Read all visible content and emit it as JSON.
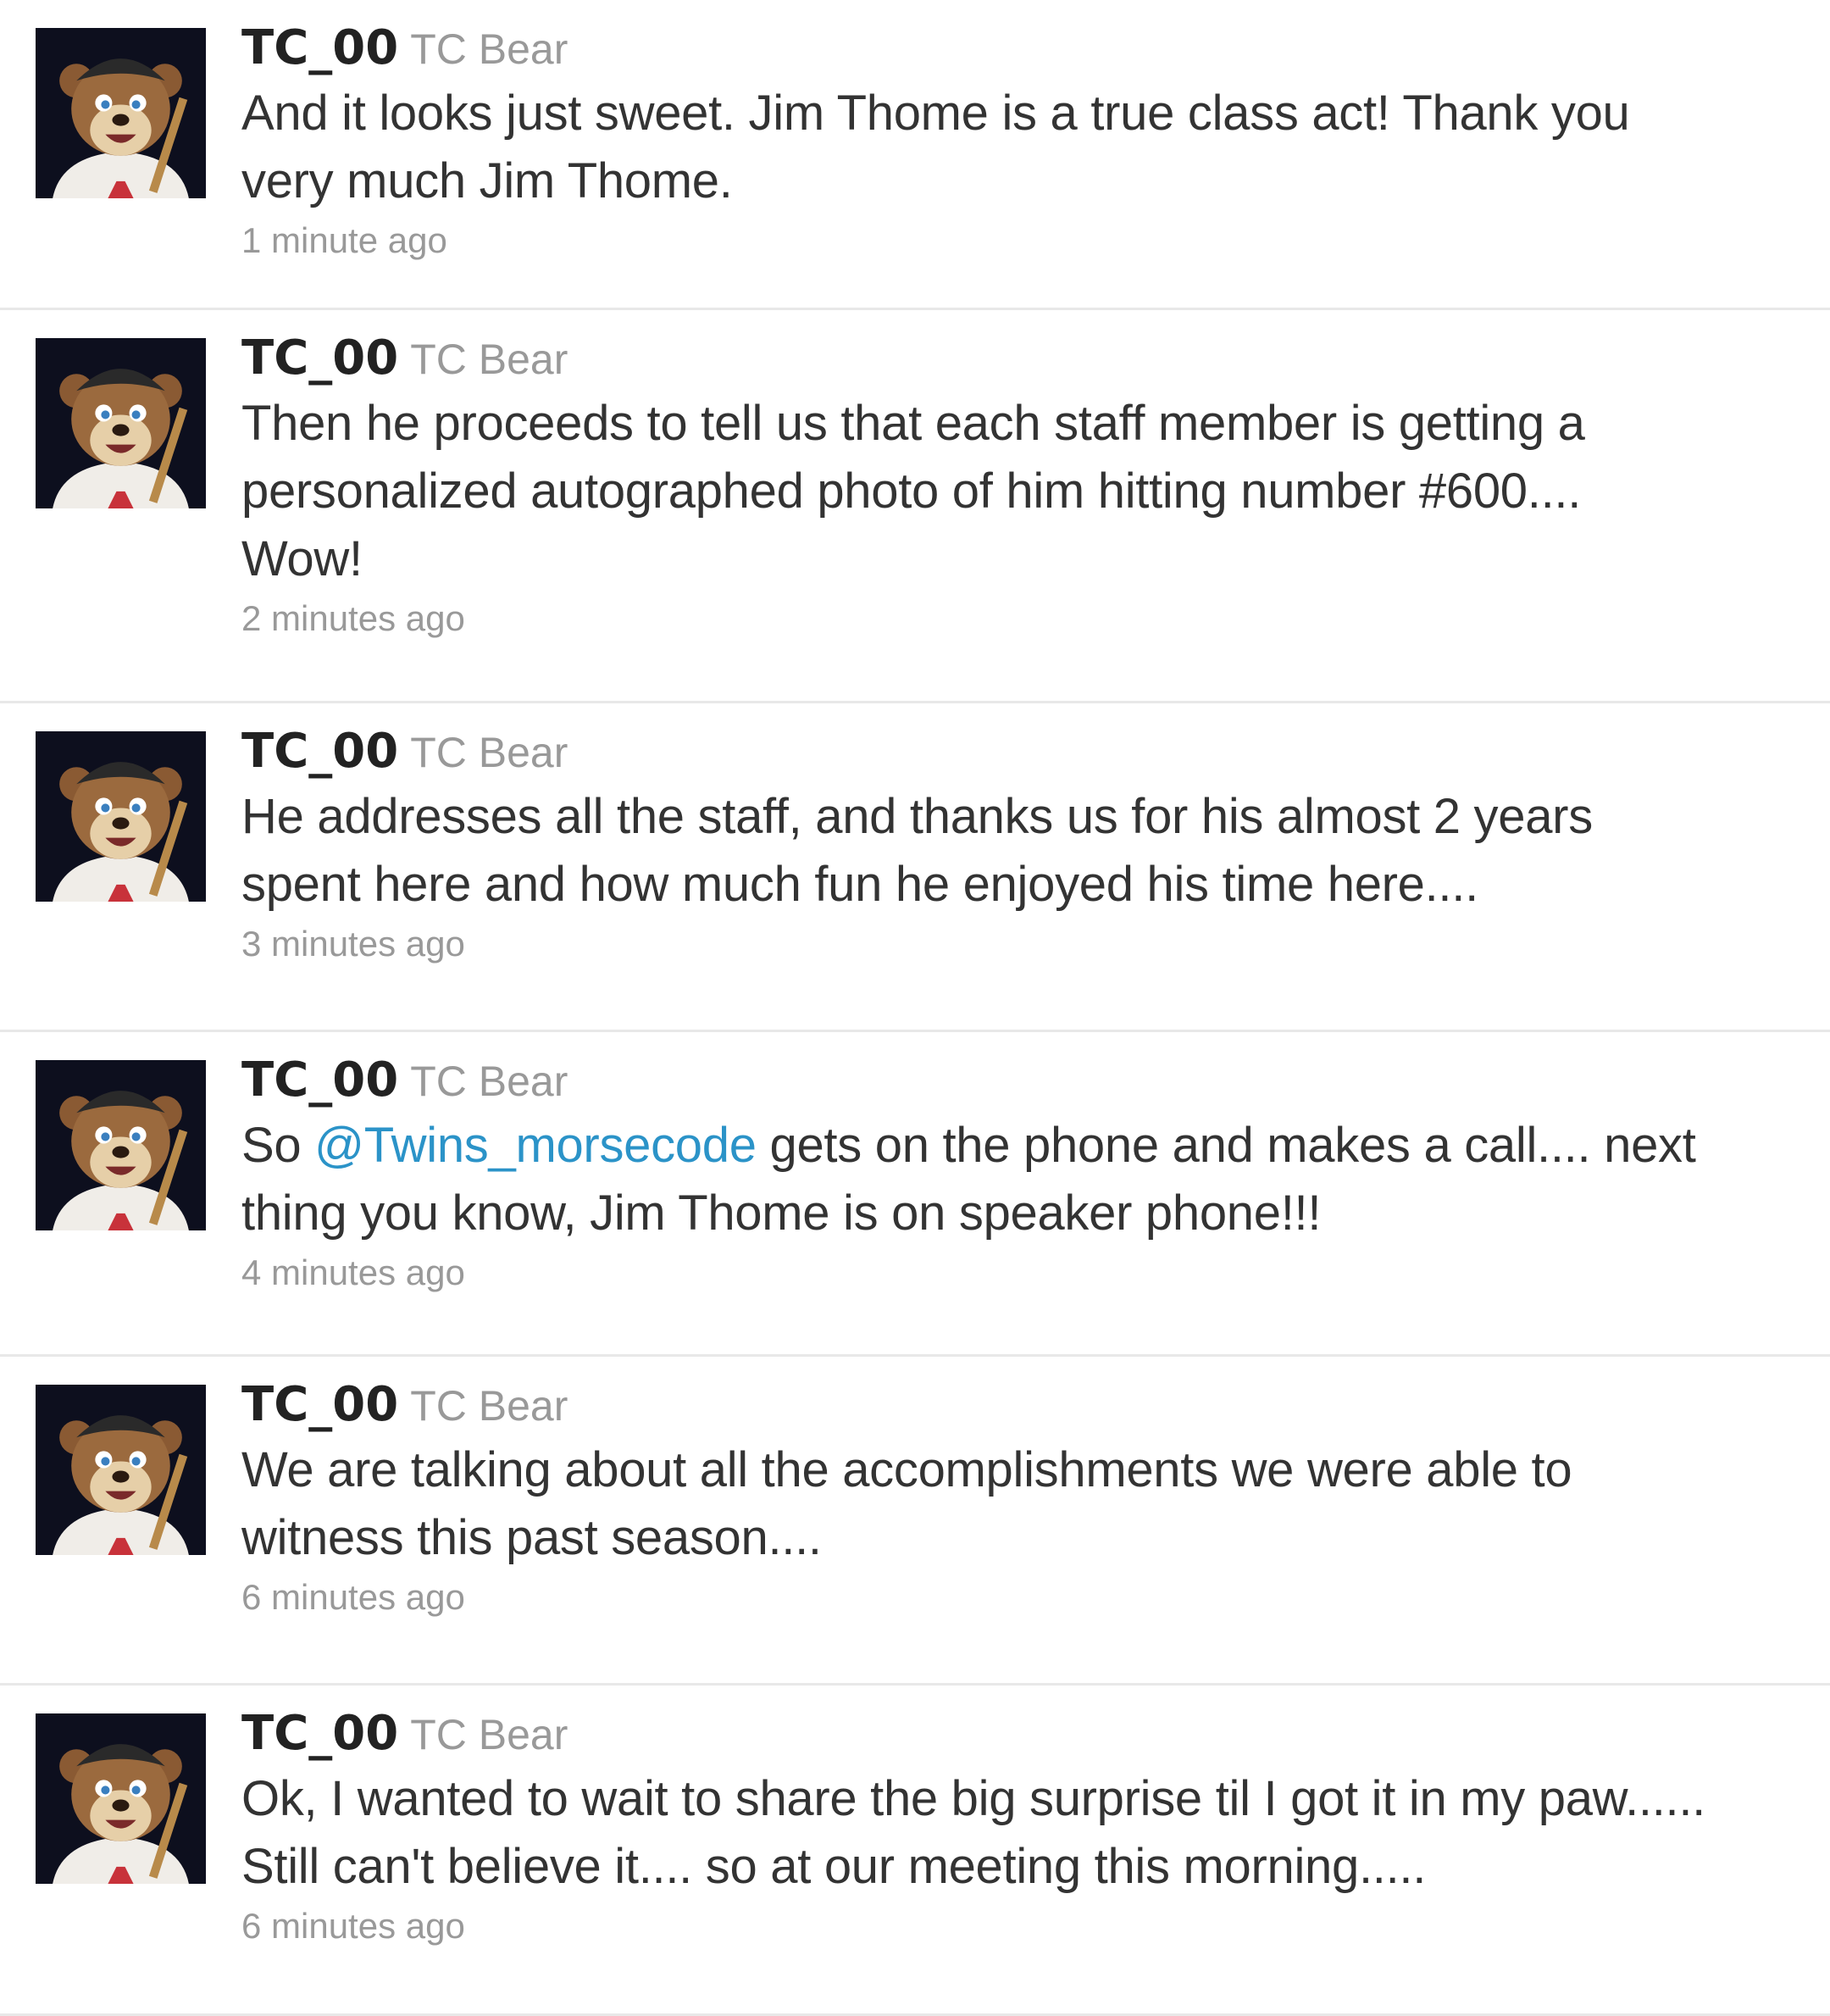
{
  "colors": {
    "screen_name": "#222222",
    "full_name": "#999999",
    "text": "#333333",
    "mention": "#2b93c8",
    "timestamp": "#999999",
    "divider": "#e8e8e8"
  },
  "tweets": [
    {
      "screen_name": "TC_00",
      "full_name": "TC Bear",
      "avatar_icon": "tc-bear-mascot-avatar",
      "lines": [
        {
          "text": "And it looks just sweet. Jim Thome is a true class act! Thank you"
        },
        {
          "text": "very much Jim Thome."
        }
      ],
      "timestamp": "1 minute ago"
    },
    {
      "screen_name": "TC_00",
      "full_name": "TC Bear",
      "avatar_icon": "tc-bear-mascot-avatar",
      "lines": [
        {
          "text": "Then he proceeds to tell us that each staff member is getting a"
        },
        {
          "text": "personalized autographed photo of him hitting number #600...."
        },
        {
          "text": "Wow!"
        }
      ],
      "timestamp": "2 minutes ago"
    },
    {
      "screen_name": "TC_00",
      "full_name": "TC Bear",
      "avatar_icon": "tc-bear-mascot-avatar",
      "lines": [
        {
          "text": "He addresses all the staff, and thanks us for his almost 2 years"
        },
        {
          "text": "spent here and how much fun he enjoyed his time here...."
        }
      ],
      "timestamp": "3 minutes ago"
    },
    {
      "screen_name": "TC_00",
      "full_name": "TC Bear",
      "avatar_icon": "tc-bear-mascot-avatar",
      "lines": [
        {
          "before": "So ",
          "mention": "@Twins_morsecode",
          "after": " gets on the phone and makes a call.... next"
        },
        {
          "text": "thing you know, Jim Thome is on speaker phone!!!"
        }
      ],
      "timestamp": "4 minutes ago"
    },
    {
      "screen_name": "TC_00",
      "full_name": "TC Bear",
      "avatar_icon": "tc-bear-mascot-avatar",
      "lines": [
        {
          "text": "We are talking about all the accomplishments we were able to"
        },
        {
          "text": "witness this past season...."
        }
      ],
      "timestamp": "6 minutes ago"
    },
    {
      "screen_name": "TC_00",
      "full_name": "TC Bear",
      "avatar_icon": "tc-bear-mascot-avatar",
      "lines": [
        {
          "text": "Ok, I wanted to wait to share the big surprise til I got it in my paw......"
        },
        {
          "text": "Still can't believe it.... so at our meeting this morning....."
        }
      ],
      "timestamp": "6 minutes ago"
    }
  ]
}
